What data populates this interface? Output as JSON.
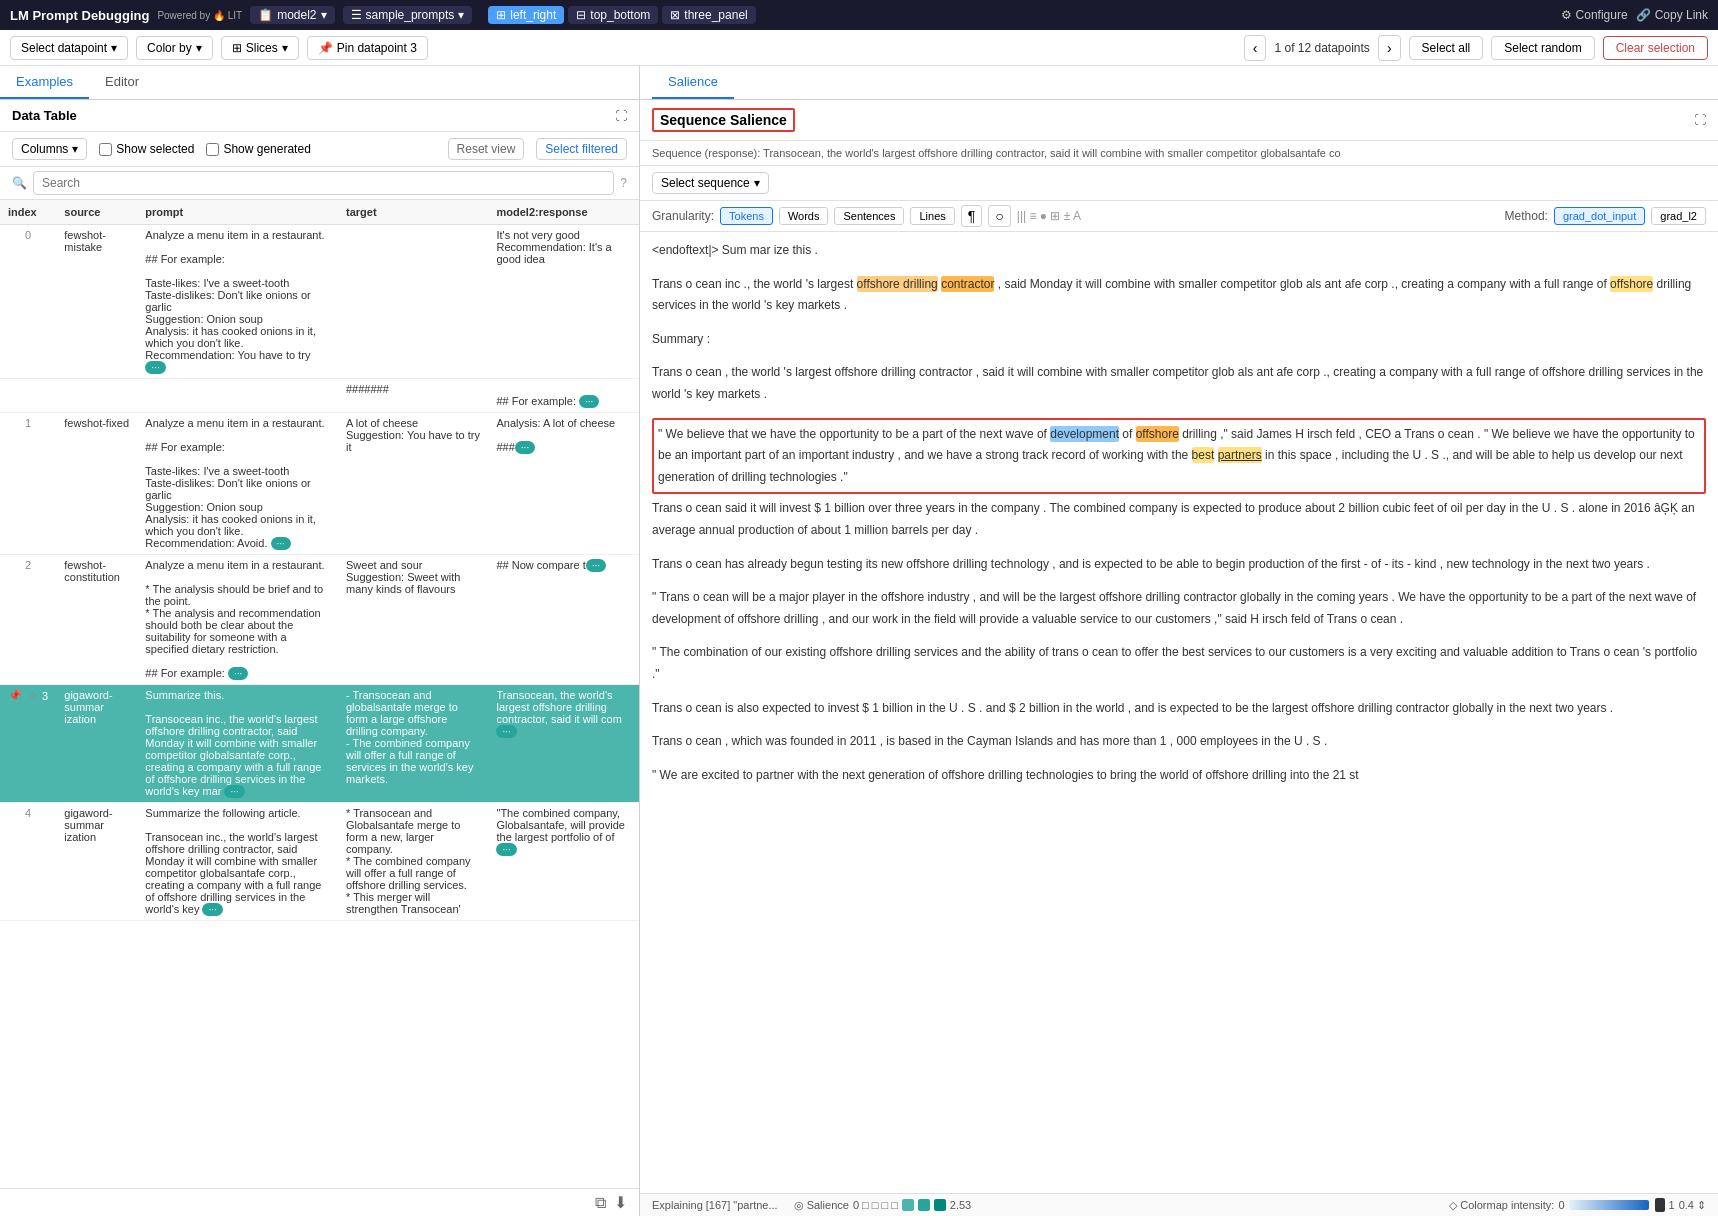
{
  "app": {
    "title": "LM Prompt Debugging",
    "powered_by": "Powered by 🔥 LIT"
  },
  "top_bar": {
    "model": "model2",
    "dataset": "sample_prompts",
    "tabs": [
      {
        "id": "left_right",
        "label": "left_right",
        "active": true
      },
      {
        "id": "top_bottom",
        "label": "top_bottom",
        "active": false
      },
      {
        "id": "three_panel",
        "label": "three_panel",
        "active": false
      }
    ],
    "configure": "Configure",
    "copy_link": "Copy Link"
  },
  "toolbar": {
    "select_datapoint": "Select datapoint",
    "color_by": "Color by",
    "slices": "Slices",
    "pin_datapoint": "Pin datapoint 3",
    "nav_prev": "‹",
    "nav_info": "1 of 12 datapoints",
    "nav_next": "›",
    "select_all": "Select all",
    "select_random": "Select random",
    "clear_selection": "Clear selection"
  },
  "left_panel": {
    "tabs": [
      "Examples",
      "Editor"
    ],
    "active_tab": "Examples",
    "data_table": {
      "title": "Data Table",
      "columns_btn": "Columns",
      "show_selected": "Show selected",
      "show_generated": "Show generated",
      "reset_view": "Reset view",
      "select_filtered": "Select filtered",
      "search_placeholder": "Search",
      "columns": [
        "index",
        "source",
        "prompt",
        "target",
        "model2:response"
      ],
      "rows": [
        {
          "index": 0,
          "source": "fewshot-mistake",
          "prompt": "Analyze a menu item in a restaurant.\n\n## For example:\n\nTaste-likes: I've a sweet-tooth\nTaste-dislikes: Don't like onions or garlic\nSuggestion: Onion soup\nAnalysis: it has cooked onions in it, which you don't like.\nRecommendation: You have to try",
          "target": "",
          "response": "It's not very good\nRecommendation: It's a good idea",
          "more_prompt": true,
          "more_response": false,
          "selected": false,
          "pinned": false,
          "starred": false
        },
        {
          "index": "",
          "source": "",
          "prompt": "",
          "target": "#######",
          "response": "",
          "more_prompt": false,
          "more_response": true,
          "selected": false,
          "pinned": false,
          "starred": false
        },
        {
          "index": "",
          "source": "",
          "prompt": "",
          "target": "## For example:",
          "response": "",
          "more_prompt": false,
          "more_response": true,
          "selected": false,
          "pinned": false,
          "starred": false
        },
        {
          "index": 1,
          "source": "fewshot-fixed",
          "prompt": "Analyze a menu item in a restaurant.\n\n## For example:\n\nTaste-likes: I've a sweet-tooth\nTaste-dislikes: Don't like onions or garlic\nSuggestion: Onion soup\nAnalysis: it has cooked onions in it, which you don't like.\nRecommendation: Avoid.",
          "target": "A lot of cheese\nSuggestion: You have to try it",
          "response": "Analysis: A lot of cheese\n\n###",
          "more_prompt": true,
          "more_response": true,
          "selected": false,
          "pinned": false,
          "starred": false
        },
        {
          "index": 2,
          "source": "fewshot-constitution",
          "prompt": "Analyze a menu item in a restaurant.\n\n* The analysis should be brief and to the point.\n* The analysis and recommendation should both be clear about the suitability for someone with a specified dietary restriction.\n\n## For example:",
          "target": "Sweet and sour\nSuggestion: Sweet with many kinds of flavours",
          "response": "## Now compare t",
          "more_prompt": true,
          "more_response": true,
          "selected": false,
          "pinned": false,
          "starred": false
        },
        {
          "index": 3,
          "source": "gigaword-summarization",
          "prompt": "Summarize this.\n\nTransocean inc., the world's largest offshore drilling contractor, said Monday it will combine with smaller competitor globalsantafe corp., creating a company with a full range of offshore drilling services in the world's key mar",
          "target": "- Transocean and globalsantafe merge to form a large offshore drilling company.\n- The combined company will offer a full range of services in the world's key markets.",
          "response": "Transocean, the world's largest offshore drilling contractor, said it will com",
          "more_prompt": true,
          "more_response": true,
          "selected": true,
          "pinned": true,
          "starred": false
        },
        {
          "index": 4,
          "source": "gigaword-summarization",
          "prompt": "Summarize the following article.\n\nTransocean inc., the world's largest offshore drilling contractor, said Monday it will combine with smaller competitor globalsantafe corp., creating a company with a full range of offshore drilling services in the world's key",
          "target": "* Transocean and Globalsantafe merge to form a new, larger company.\n* The combined company will offer a full range of offshore drilling services.\n* This merger will strengthen Transocean'",
          "response": "\"The combined company, Globalsantafe, will provide the largest portfolio of of",
          "more_prompt": true,
          "more_response": true,
          "selected": false,
          "pinned": false,
          "starred": false
        }
      ]
    }
  },
  "right_panel": {
    "tabs": [
      "Salience"
    ],
    "active_tab": "Salience",
    "salience": {
      "title": "Sequence Salience",
      "sequence_info": "Sequence (response): Transocean, the world's largest offshore drilling contractor, said it will combine with smaller competitor globalsantafe co",
      "select_sequence": "Select sequence",
      "granularity": {
        "label": "Granularity:",
        "options": [
          "Tokens",
          "Words",
          "Sentences",
          "Lines"
        ],
        "active": "Tokens",
        "extra_options": [
          "¶",
          "○"
        ]
      },
      "method": {
        "label": "Method:",
        "options": [
          "grad_dot_input",
          "grad_l2"
        ],
        "active": "grad_dot_input"
      },
      "content_blocks": [
        {
          "id": "block1",
          "text": "<endoftext|> Sum mar ize this ."
        },
        {
          "id": "block2",
          "text": "Trans o cean inc ., the world 's largest offshore drilling contractor , said Monday it will combine with smaller competitor glob als ant afe corp ., creating a company with a full range of offshore drilling services in the world 's key markets ."
        },
        {
          "id": "block3",
          "text": "Summary :"
        },
        {
          "id": "block4",
          "text": "Trans o cean , the world 's largest offshore drilling contractor , said it will combine with smaller competitor glob als ant afe corp ., creating a company with a full range of offshore drilling services in the world 's key markets ."
        },
        {
          "id": "block5_highlighted",
          "text": "\" We believe that we have the opportunity to be a part of the next wave of development of offshore drilling ,\" said James H irsch feld , CEO a Trans o cean . \" We believe we have the opportunity to be an important part of an important industry , and we have a strong track record of working with the best partners in this space , including the U . S ., and will be able to help us develop our next generation of drilling technologies .\""
        },
        {
          "id": "block6",
          "text": "Trans o cean said it will invest $ 1 billion over three years in the company . The combined company is expected to produce about 2 billion cubic feet of oil per day in the U . S . alone in 2016 âĢĶ an average annual production of about 1 million barrels per day ."
        },
        {
          "id": "block7",
          "text": "Trans o cean has already begun testing its new offshore drilling technology , and is expected to be able to begin production of the first - of - its - kind , new technology in the next two years ."
        },
        {
          "id": "block8",
          "text": "\" Trans o cean will be a major player in the offshore industry , and will be the largest offshore drilling contractor globally in the coming years . We have the opportunity to be a part of the next wave of development of offshore drilling , and our work in the field will provide a valuable service to our customers ,\" said H irsch feld of Trans o cean ."
        },
        {
          "id": "block9",
          "text": "\" The combination of our existing offshore drilling services and the ability of trans o cean to offer the best services to our customers is a very exciting and valuable addition to Trans o cean 's portfolio .\""
        },
        {
          "id": "block10",
          "text": "Trans o cean is also expected to invest $ 1 billion in the U . S . and $ 2 billion in the world , and is expected to be the largest offshore drilling contractor globally in the next two years ."
        },
        {
          "id": "block11",
          "text": "Trans o cean , which was founded in 2011 , is based in the Cayman Islands and has more than 1 , 000 employees in the U . S ."
        },
        {
          "id": "block12",
          "text": "\" We are excited to partner with the next generation of offshore drilling technologies to bring the world of offshore drilling into the 21 st"
        }
      ],
      "status_bar": {
        "explaining": "Explaining [167] \"partne...",
        "salience_label": "◎ Salience",
        "salience_value": "0",
        "salience_squares": [
          "□",
          "□",
          "□",
          "□",
          "■",
          "■",
          "■"
        ],
        "salience_num": "2.53",
        "colormap_label": "◇ Colormap intensity:",
        "colormap_min": "0",
        "colormap_max": "1",
        "colormap_value": "0.4"
      }
    }
  }
}
